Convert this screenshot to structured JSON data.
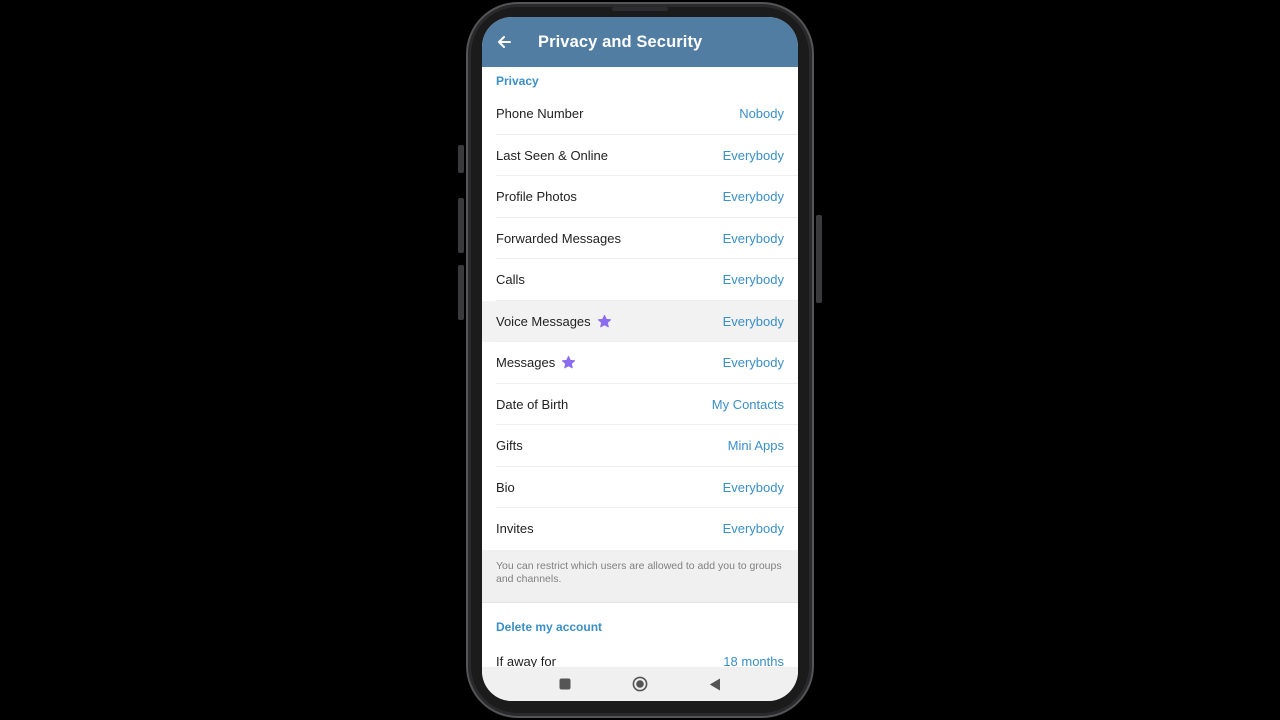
{
  "header": {
    "title": "Privacy and Security"
  },
  "privacy": {
    "section_title": "Privacy",
    "items": [
      {
        "label": "Phone Number",
        "value": "Nobody"
      },
      {
        "label": "Last Seen & Online",
        "value": "Everybody"
      },
      {
        "label": "Profile Photos",
        "value": "Everybody"
      },
      {
        "label": "Forwarded Messages",
        "value": "Everybody"
      },
      {
        "label": "Calls",
        "value": "Everybody"
      },
      {
        "label": "Voice Messages",
        "value": "Everybody",
        "premium_icon": "star-icon"
      },
      {
        "label": "Messages",
        "value": "Everybody",
        "premium_icon": "star-icon"
      },
      {
        "label": "Date of Birth",
        "value": "My Contacts"
      },
      {
        "label": "Gifts",
        "value": "Mini Apps"
      },
      {
        "label": "Bio",
        "value": "Everybody"
      },
      {
        "label": "Invites",
        "value": "Everybody"
      }
    ],
    "info_text": "You can restrict which users are allowed to add you to groups and channels."
  },
  "delete_account": {
    "section_title": "Delete my account",
    "item": {
      "label": "If away for",
      "value": "18 months"
    }
  },
  "colors": {
    "appbar": "#517da2",
    "accent": "#3a8fc7",
    "premium_star": "#8b6cf0"
  },
  "icons": {
    "back": "arrow-left-icon",
    "nav": [
      "square-icon",
      "circle-icon",
      "triangle-back-icon"
    ]
  }
}
